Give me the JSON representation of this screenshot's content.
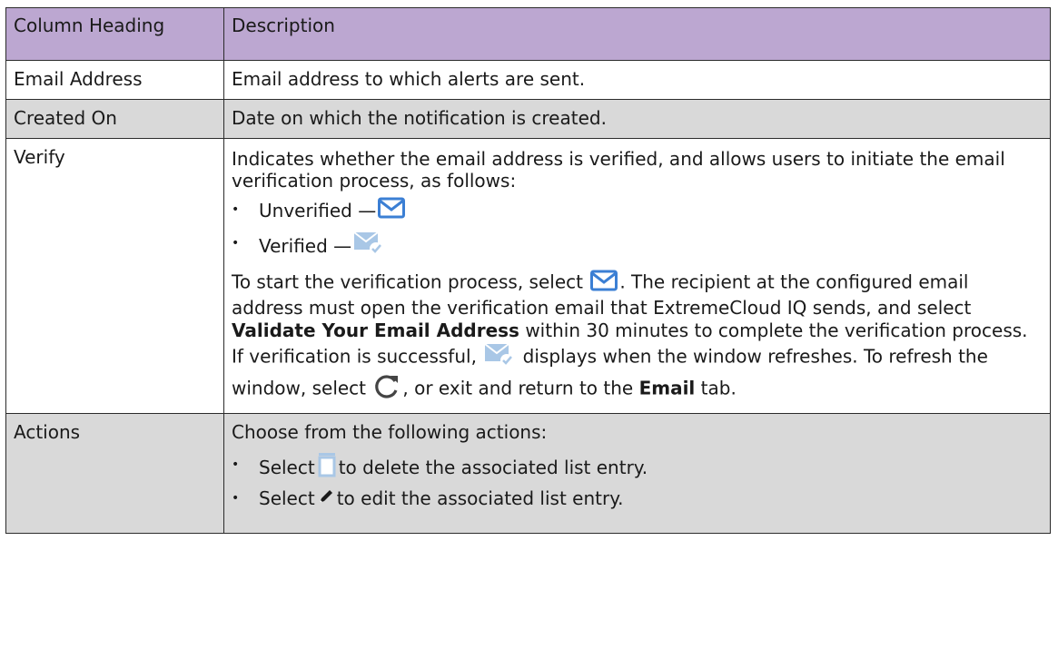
{
  "table": {
    "headers": [
      "Column Heading",
      "Description"
    ],
    "rows": {
      "email": {
        "heading": "Email Address",
        "description": "Email address to which alerts are sent."
      },
      "created": {
        "heading": "Created On",
        "description": "Date on which the notification is created."
      },
      "verify": {
        "heading": "Verify",
        "intro": "Indicates whether the email address is verified, and allows users to initiate the email verification process, as follows:",
        "unverified_label": "Unverified —",
        "verified_label": "Verified —",
        "p1_start": "To start the verification process, select",
        "p1_mid": ". The recipient at the configured email address must open the verification email that ExtremeCloud IQ sends, and select",
        "p1_bold": "Validate Your Email Address",
        "p1_end": "within 30 minutes to complete the verification process. If verification is successful,",
        "p2_mid": "displays when the window refreshes. To refresh the window, select",
        "p2_after_refresh": ", or exit and return to the",
        "p2_bold": "Email",
        "p2_end": "tab."
      },
      "actions": {
        "heading": "Actions",
        "intro": "Choose from the following actions:",
        "delete_pre": "Select",
        "delete_post": "to delete the associated list entry.",
        "edit_pre": "Select",
        "edit_post": "to edit the associated list entry."
      }
    }
  },
  "colors": {
    "header_bg": "#bca7d1",
    "alt_row_bg": "#d9d9d9",
    "icon_blue": "#3b7fd4",
    "icon_light": "#a9c7e6"
  },
  "icons": [
    "envelope-icon",
    "envelope-verified-icon",
    "refresh-icon",
    "trash-icon",
    "pencil-icon"
  ]
}
